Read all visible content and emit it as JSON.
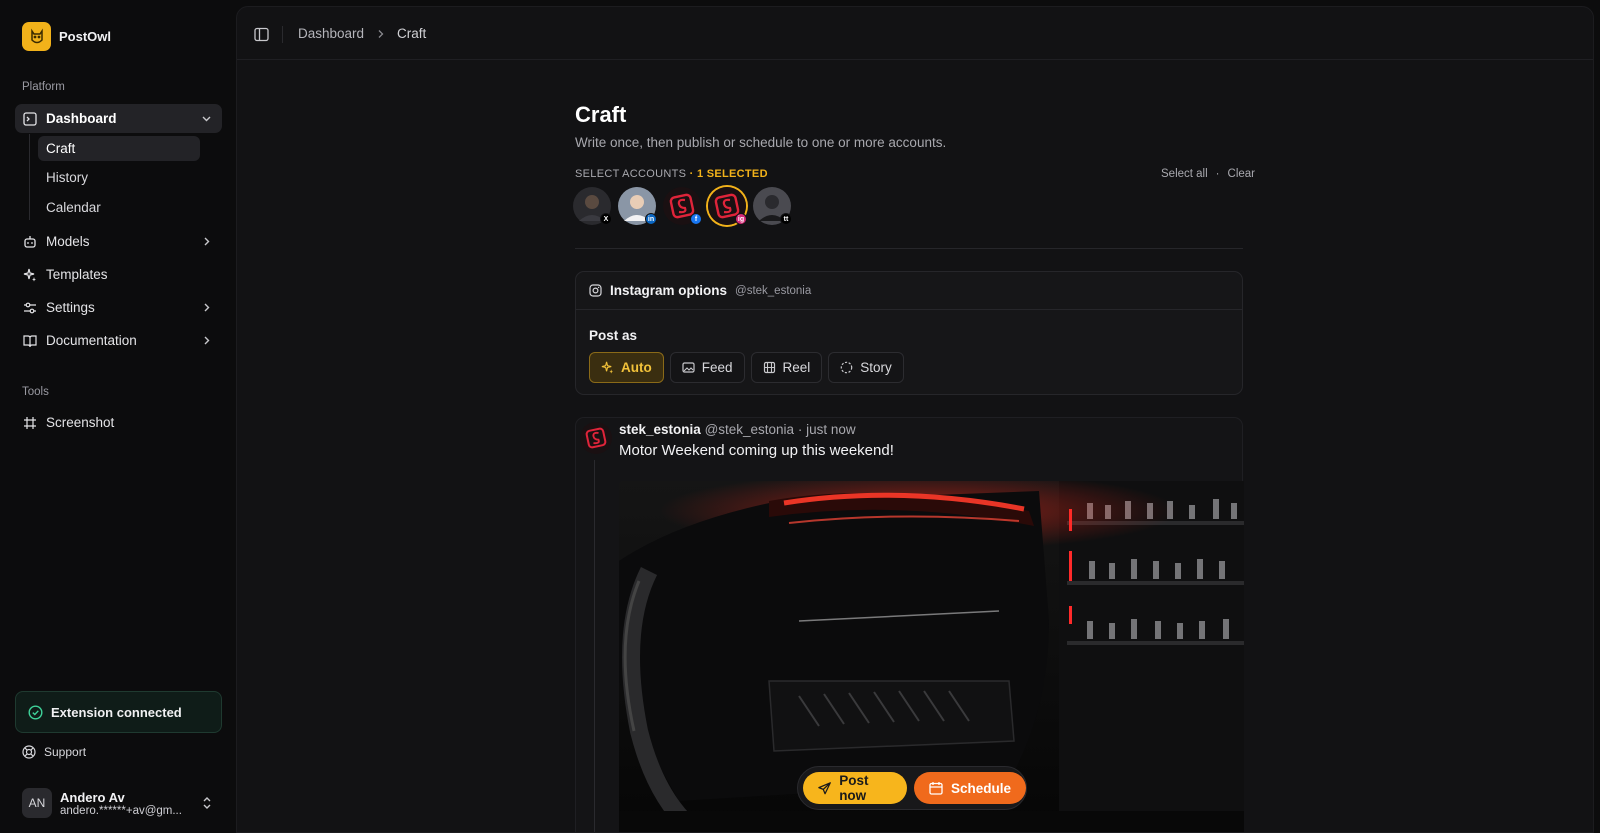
{
  "app": {
    "name": "PostOwl"
  },
  "sidebar": {
    "platform_label": "Platform",
    "tools_label": "Tools",
    "items": [
      {
        "label": "Dashboard",
        "icon": "dashboard-icon",
        "expanded": true
      },
      {
        "label": "Models",
        "icon": "models-icon"
      },
      {
        "label": "Templates",
        "icon": "sparkles-icon"
      },
      {
        "label": "Settings",
        "icon": "settings-icon"
      },
      {
        "label": "Documentation",
        "icon": "book-icon"
      }
    ],
    "subitems": [
      "Craft",
      "History",
      "Calendar"
    ],
    "tools": [
      {
        "label": "Screenshot",
        "icon": "frame-icon"
      }
    ],
    "extension_status": "Extension connected",
    "support_label": "Support",
    "user": {
      "initials": "AN",
      "name": "Andero Av",
      "email": "andero.******+av@gm..."
    }
  },
  "topbar": {
    "breadcrumb": [
      "Dashboard",
      "Craft"
    ]
  },
  "page": {
    "title": "Craft",
    "subtitle": "Write once, then publish or schedule to one or more accounts.",
    "select_accounts_label": "SELECT ACCOUNTS",
    "selected_count_label": "· 1 SELECTED",
    "select_all": "Select all",
    "separator": "·",
    "clear": "Clear",
    "accounts": [
      {
        "network": "x",
        "badge": "X",
        "selected": false
      },
      {
        "network": "linkedin",
        "badge": "in",
        "selected": false
      },
      {
        "network": "facebook",
        "badge": "f",
        "selected": false
      },
      {
        "network": "instagram",
        "badge": "ig",
        "selected": true
      },
      {
        "network": "tiktok",
        "badge": "tt",
        "selected": false
      }
    ]
  },
  "instagram_options": {
    "title": "Instagram options",
    "handle": "@stek_estonia",
    "post_as_label": "Post as",
    "options": [
      {
        "label": "Auto",
        "icon": "sparkles-icon",
        "active": true
      },
      {
        "label": "Feed",
        "icon": "image-icon",
        "active": false
      },
      {
        "label": "Reel",
        "icon": "film-icon",
        "active": false
      },
      {
        "label": "Story",
        "icon": "story-icon",
        "active": false
      }
    ]
  },
  "preview": {
    "name": "stek_estonia",
    "handle": "@stek_estonia",
    "time": "· just now",
    "text": "Motor Weekend coming up this weekend!"
  },
  "actions": {
    "post_now": "Post now",
    "schedule": "Schedule"
  },
  "colors": {
    "accent": "#f7b51c",
    "schedule": "#f06a1c",
    "background": "#0c0c0d",
    "panel": "#121214"
  }
}
